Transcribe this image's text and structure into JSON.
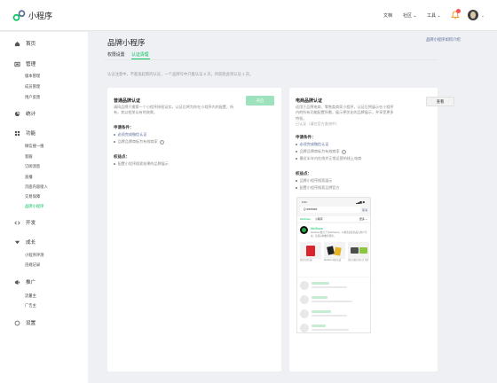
{
  "app": {
    "title": "小程序"
  },
  "top_nav": [
    {
      "label": "文档"
    },
    {
      "label": "社区 ⌄"
    },
    {
      "label": "工具 ⌄"
    }
  ],
  "icons": {
    "logo": "mini-program-logo",
    "bell": "bell-icon",
    "avatar": "user-avatar",
    "home": "home-icon",
    "manage": "manage-icon",
    "stats": "stats-icon",
    "features": "features-icon",
    "dev": "code-icon",
    "growth": "growth-icon",
    "promote": "promote-icon",
    "settings": "settings-icon",
    "help": "question-icon"
  },
  "colors": {
    "accent": "#07c160",
    "link": "#576b95",
    "badge": "#fa5151"
  },
  "sidebar": {
    "sections": [
      {
        "label": "首页",
        "items": []
      },
      {
        "label": "管理",
        "items": [
          "版本管理",
          "成员管理",
          "用户反馈"
        ]
      },
      {
        "label": "统计",
        "items": []
      },
      {
        "label": "功能",
        "items": [
          "微信搜一搜",
          "客服",
          "订阅消息",
          "直播",
          "页面内容接入",
          "交易保障",
          "品牌小程序"
        ]
      },
      {
        "label": "开发",
        "items": []
      },
      {
        "label": "成长",
        "items": [
          "小程序评测",
          "违规记录"
        ]
      },
      {
        "label": "推广",
        "items": [
          "流量主",
          "广告主"
        ]
      },
      {
        "label": "设置",
        "items": []
      }
    ],
    "active_item": "品牌小程序"
  },
  "main": {
    "title": "品牌小程序",
    "help_link": "品牌小程序如何介绍",
    "tabs": [
      {
        "label": "权限设置"
      },
      {
        "label": "认证清理"
      }
    ],
    "intro": "认证注意中，不能发起新的认证，一个品牌号中只能认证 2 次，目前距此项认证 1 次。"
  },
  "card_normal": {
    "title": "普通品牌认证",
    "desc": "请同品牌只需第一个小程序授权证实，认证后将为你在小程序内的配置，所有，其以相关以有的效果。",
    "button": "开启",
    "cond_title": "申请条件：",
    "conditions": [
      {
        "text": "必须完成微信认证",
        "link": true
      },
      {
        "text": "品牌品牌商标为有效商家",
        "link": false,
        "help": true
      }
    ],
    "rights_title": "权益点：",
    "rights": [
      "配置小程序搜索结果的品牌展示"
    ]
  },
  "card_premium": {
    "title": "电商品牌认证",
    "desc": "适用于品牌电商、零售类商家小程序，认证后将展示在小程序内的所有功能配置所需，展示更优化的品牌展示，并享受更多特权。",
    "note": "已认证（请在官方查询中）",
    "button": "查看",
    "cond_title": "申请条件：",
    "conditions": [
      {
        "text": "必须完成微信认证",
        "link": true
      },
      {
        "text": "品牌品牌商标为有效商家",
        "link": false,
        "help": true
      },
      {
        "text": "最近半年内在线并正常运营的线上电商",
        "link": false
      }
    ],
    "rights_title": "权益点：",
    "rights": [
      "品牌小程序搜索展示",
      "配置小程序搜索品牌官方"
    ]
  },
  "phone": {
    "time": "9:41",
    "signal": "▂▄▆ ◼",
    "search_text": "Q  weshare",
    "cancel": "取消",
    "tabs": [
      {
        "label": "WeShare",
        "green": true
      },
      {
        "label": "小程序"
      },
      {
        "label": "更多 ⌄"
      }
    ],
    "brand_name": "WeShare",
    "brand_desc": "WeShare致力于为WeSpace，以精选优质商品为用户带来，优质好物推荐服务。",
    "products": [
      {
        "label": "彩色红包封面"
      },
      {
        "label": "WeShare 限定礼盒"
      },
      {
        "label": "金色可爱护身卡片 挂件"
      }
    ]
  }
}
